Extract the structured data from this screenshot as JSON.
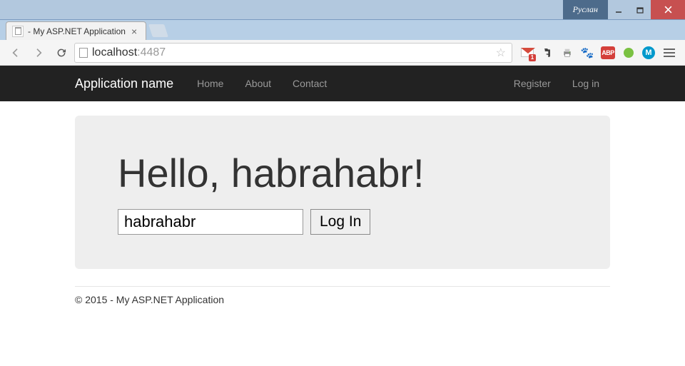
{
  "window": {
    "user": "Руслан"
  },
  "tab": {
    "title": "- My ASP.NET Application"
  },
  "address": {
    "host": "localhost",
    "port": ":4487"
  },
  "navbar": {
    "brand": "Application name",
    "links": [
      "Home",
      "About",
      "Contact"
    ],
    "right": [
      "Register",
      "Log in"
    ]
  },
  "page": {
    "heading": "Hello, habrahabr!",
    "input_value": "habrahabr",
    "login_button": "Log In",
    "footer": "© 2015 - My ASP.NET Application"
  },
  "extensions": {
    "gmail_badge": "1",
    "abp_label": "ABP",
    "m_label": "M"
  }
}
